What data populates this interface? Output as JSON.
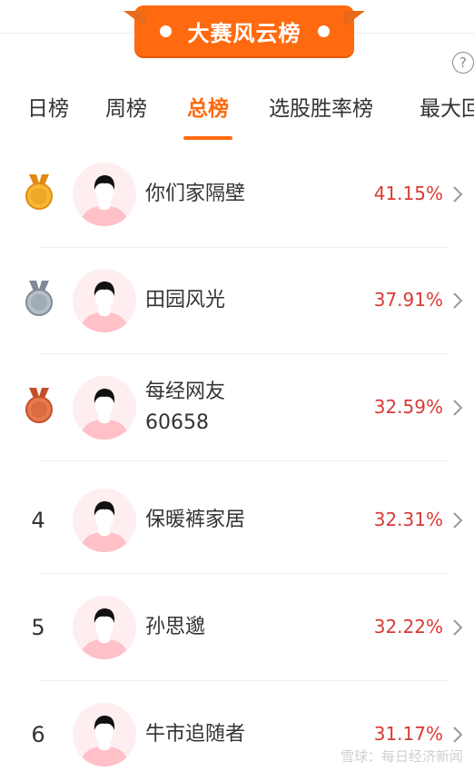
{
  "banner": {
    "title": "大赛风云榜"
  },
  "tabs": [
    {
      "label": "日榜",
      "active": false
    },
    {
      "label": "周榜",
      "active": false
    },
    {
      "label": "总榜",
      "active": true
    },
    {
      "label": "选股胜率榜",
      "active": false
    },
    {
      "label": "最大回",
      "active": false
    }
  ],
  "help_icon": "question-icon",
  "rows": [
    {
      "rank": "1",
      "medal": "gold",
      "name": "你们家隔壁",
      "rate": "41.15%"
    },
    {
      "rank": "2",
      "medal": "silver",
      "name": "田园风光",
      "rate": "37.91%"
    },
    {
      "rank": "3",
      "medal": "bronze",
      "name": "每经网友60658",
      "name_line1": "每经网友",
      "name_line2": "60658",
      "rate": "32.59%"
    },
    {
      "rank": "4",
      "medal": null,
      "name": "保暖裤家居",
      "rate": "32.31%"
    },
    {
      "rank": "5",
      "medal": null,
      "name": "孙思邈",
      "rate": "32.22%"
    },
    {
      "rank": "6",
      "medal": null,
      "name": "牛市追随者",
      "rate": "31.17%"
    }
  ],
  "colors": {
    "accent": "#ff6a10",
    "rate": "#d83a34",
    "gold": "#f0a41c",
    "silver": "#9aa5b1",
    "bronze": "#d9643a"
  },
  "watermark": "雪球：每日经济新闻"
}
